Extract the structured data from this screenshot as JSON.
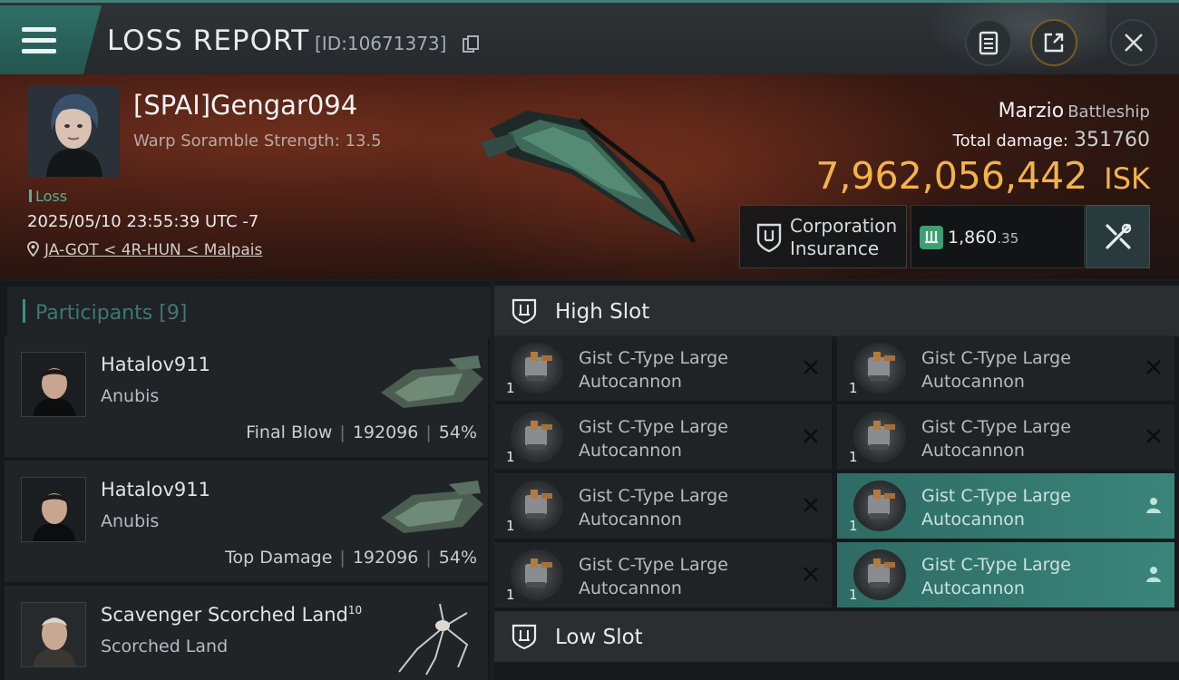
{
  "header": {
    "title": "LOSS REPORT",
    "report_id": "[ID:10671373]",
    "icons": [
      "menu-icon",
      "copy-icon",
      "clipboard-icon",
      "share-icon",
      "close-icon"
    ]
  },
  "victim": {
    "name": "[SPAI]Gengar094",
    "warp_scramble": "Warp Soramble Strength: 13.5",
    "status": "Loss",
    "datetime": "2025/05/10 23:55:39 UTC -7",
    "location": "JA-GOT < 4R-HUN < Malpais",
    "ship_name": "Marzio",
    "ship_class": "Battleship",
    "total_damage_label": "Total damage:",
    "total_damage": "351760",
    "isk_value": "7,962,056,442",
    "isk_unit": "ISK",
    "insurance_label_1": "Corporation",
    "insurance_label_2": "Insurance",
    "plex_value": "1,860",
    "plex_decimal": ".35"
  },
  "participants": {
    "title": "Participants",
    "count": "[9]",
    "items": [
      {
        "name": "Hatalov911",
        "ship": "Anubis",
        "role": "Final Blow",
        "damage": "192096",
        "percent": "54%"
      },
      {
        "name": "Hatalov911",
        "ship": "Anubis",
        "role": "Top Damage",
        "damage": "192096",
        "percent": "54%"
      },
      {
        "name": "Scavenger Scorched Land",
        "level": "10",
        "ship": "Scorched Land"
      }
    ]
  },
  "fitting": {
    "high_slot_title": "High Slot",
    "low_slot_title": "Low Slot",
    "modules": [
      {
        "line1": "Gist C-Type Large",
        "line2": "Autocannon",
        "qty": "1",
        "state": "destroyed"
      },
      {
        "line1": "Gist C-Type Large",
        "line2": "Autocannon",
        "qty": "1",
        "state": "destroyed"
      },
      {
        "line1": "Gist C-Type Large",
        "line2": "Autocannon",
        "qty": "1",
        "state": "destroyed"
      },
      {
        "line1": "Gist C-Type Large",
        "line2": "Autocannon",
        "qty": "1",
        "state": "destroyed"
      },
      {
        "line1": "Gist C-Type Large",
        "line2": "Autocannon",
        "qty": "1",
        "state": "destroyed"
      },
      {
        "line1": "Gist C-Type Large",
        "line2": "Autocannon",
        "qty": "1",
        "state": "dropped"
      },
      {
        "line1": "Gist C-Type Large",
        "line2": "Autocannon",
        "qty": "1",
        "state": "destroyed"
      },
      {
        "line1": "Gist C-Type Large",
        "line2": "Autocannon",
        "qty": "1",
        "state": "dropped"
      }
    ]
  },
  "colors": {
    "accent_teal": "#3b8f86",
    "isk_gold": "#f4b24a",
    "loss_green": "#4fb39a"
  }
}
